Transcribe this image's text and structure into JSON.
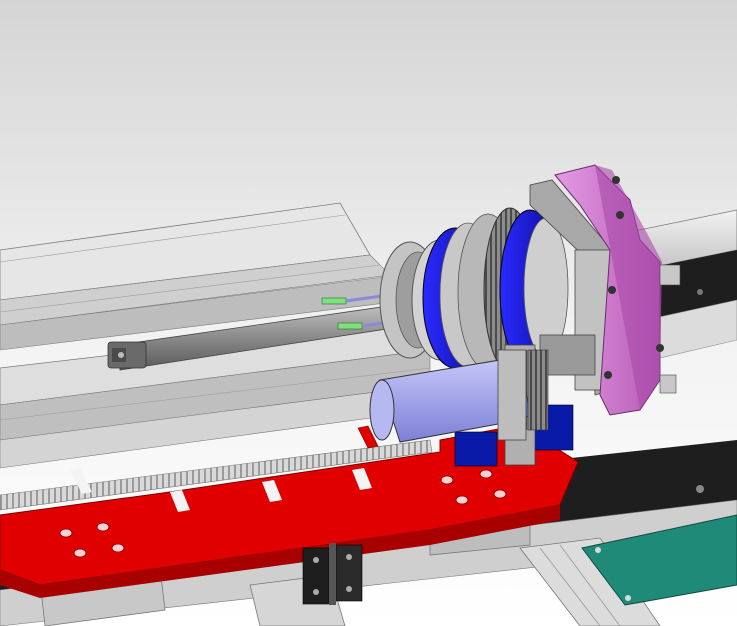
{
  "viewport": {
    "background_top": "#d7d7d7",
    "background_bottom": "#ffffff"
  },
  "colors": {
    "rail_light": "#eaeaea",
    "rail_mid": "#c4c4c4",
    "rail_dark": "#8a8a8a",
    "track_black": "#1e1e1e",
    "red_plate": "#e10000",
    "red_plate_side": "#a80000",
    "blue_ring": "#1f1fd6",
    "blue_block": "#0a1aa8",
    "magenta_flange": "#d97ad9",
    "magenta_shadow": "#a84aa8",
    "gear_grey": "#7d7d7d",
    "motor_lavender": "#a6a8ee",
    "teal_pcb": "#1f8a78",
    "shaft_grey": "#9a9a9a",
    "pin_green": "#7ee07e"
  },
  "components": [
    "upper-guide-rail",
    "lower-guide-rail",
    "shaft",
    "rotary-chuck",
    "ring-gear",
    "flange-plate",
    "drive-motor",
    "red-base-plate",
    "rack",
    "door-hinge",
    "pcb-board"
  ]
}
